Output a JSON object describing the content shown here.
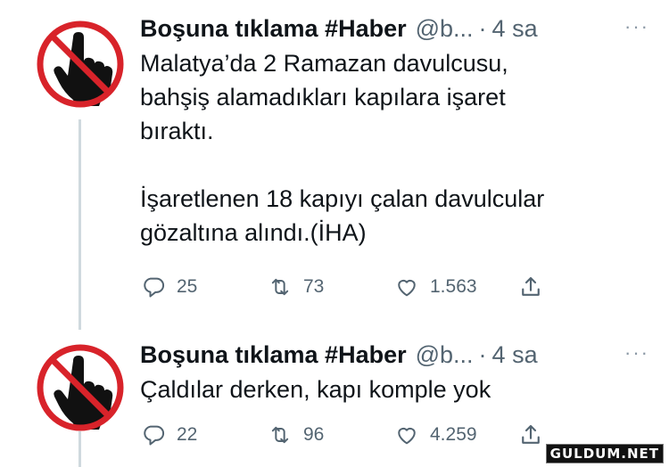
{
  "tweets": [
    {
      "name": "Boşuna tıklama #Haber",
      "handle": "@b...",
      "dot": "·",
      "time": "4 sa",
      "more": "···",
      "text": "Malatya’da 2 Ramazan davulcusu,\nbahşiş alamadıkları kapılara işaret\nbıraktı.\n\nİşaretlenen 18 kapıyı çalan davulcular\ngözaltına alındı.(İHA)",
      "replies": "25",
      "retweets": "73",
      "likes": "1.563"
    },
    {
      "name": "Boşuna tıklama #Haber",
      "handle": "@b...",
      "dot": "·",
      "time": "4 sa",
      "more": "···",
      "text": "Çaldılar derken, kapı komple yok",
      "replies": "22",
      "retweets": "96",
      "likes": "4.259"
    }
  ],
  "colors": {
    "avatar_ring": "#d8232a",
    "text": "#0f1419",
    "muted": "#536471",
    "thread_line": "#cfd9de"
  },
  "icons": [
    "no-click-hand-avatar-icon",
    "reply-icon",
    "retweet-icon",
    "like-icon",
    "share-icon",
    "more-icon"
  ],
  "watermark": "GULDUM.NET"
}
